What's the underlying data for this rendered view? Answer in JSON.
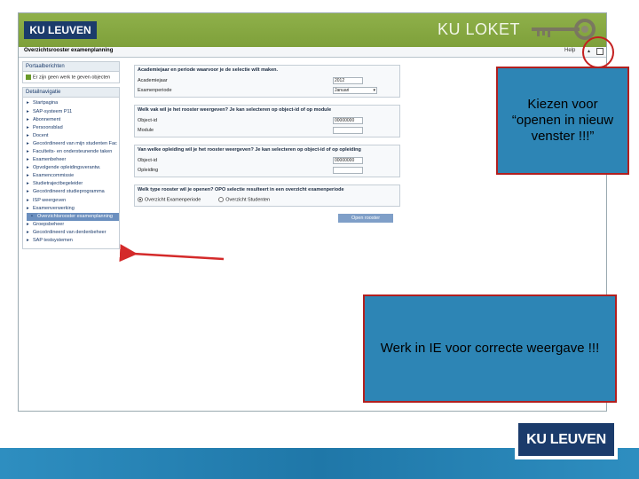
{
  "banner": {
    "logo_text": "KU LEUVEN",
    "app_title": "KU LOKET",
    "brand_color": "#7ea03a",
    "icon": "keys-icon"
  },
  "topbar": {
    "page_title": "Overzichtsrooster examenplanning",
    "help_label": "Help",
    "arrow_glyph": "▴",
    "newwin_icon": "new-window-icon"
  },
  "leftnav": {
    "portaal_head": "Portaalberichten",
    "portaal_item": "Er zijn geen werk te geven objecten",
    "deel_head": "Detailnavigatie",
    "items": [
      {
        "label": "Startpagina",
        "level": 0,
        "active": false
      },
      {
        "label": "SAP-systeem P11",
        "level": 0,
        "active": false
      },
      {
        "label": "Abonnement",
        "level": 0,
        "active": false
      },
      {
        "label": "Persoonsblad",
        "level": 0,
        "active": false
      },
      {
        "label": "Docent",
        "level": 0,
        "active": false
      },
      {
        "label": "Gecoördineerd van mijn studenten Fac",
        "level": 0,
        "active": false
      },
      {
        "label": "Faculteits- en ondersteunende taken",
        "level": 0,
        "active": false
      },
      {
        "label": "Examenbeheer",
        "level": 0,
        "active": false
      },
      {
        "label": "Opvolgende opleidingsverantw.",
        "level": 0,
        "active": false
      },
      {
        "label": "Examencommissie",
        "level": 0,
        "active": false
      },
      {
        "label": "Studietrajectbegeleider",
        "level": 0,
        "active": false
      },
      {
        "label": "Gecoördineerd studieprogramma",
        "level": 0,
        "active": false
      },
      {
        "label": "ISP weergeven",
        "level": 0,
        "active": false
      },
      {
        "label": "Examenverwerking",
        "level": 0,
        "active": false
      },
      {
        "label": "Overzichtsrooster examenplanning",
        "level": 1,
        "active": true
      },
      {
        "label": "Groepsbeheer",
        "level": 0,
        "active": false
      },
      {
        "label": "Gecoördineerd van derdenbeheer",
        "level": 0,
        "active": false
      },
      {
        "label": "SAP testsystemen",
        "level": 0,
        "active": false
      }
    ]
  },
  "form": {
    "sec1_head": "Academiejaar en periode waarvoor je de selectie wilt maken.",
    "academiejaar_label": "Academiejaar",
    "academiejaar_value": "2012",
    "periode_label": "Examenperiode",
    "periode_value": "Januari",
    "sec2_head": "Welk vak wil je het rooster weergeven? Je kan selecteren op object-id of op module",
    "objectid_label": "Object-id",
    "objectid_value": "00000000",
    "module_label": "Module",
    "sec3_head": "Van welke opleiding wil je het rooster weergeven? Je kan selecteren op object-id of op opleiding",
    "objectid2_label": "Object-id",
    "objectid2_value": "00000000",
    "opleiding_label": "Opleiding",
    "sec4_head": "Welk type rooster wil je openen? OPO selectie resulteert in een overzicht examenperiode",
    "radio1_label": "Overzicht Examenperiode",
    "radio2_label": "Overzicht Studenten",
    "open_btn": "Open rooster"
  },
  "callouts": {
    "new_window": "Kiezen voor “openen in nieuw venster !!!”",
    "ie_note": "Werk in IE voor correcte weergave !!!",
    "fill_color": "#2d85b5",
    "border_color": "#b21f1f"
  },
  "footer": {
    "logo_text": "KU LEUVEN",
    "bar_color": "#1f77a8"
  }
}
